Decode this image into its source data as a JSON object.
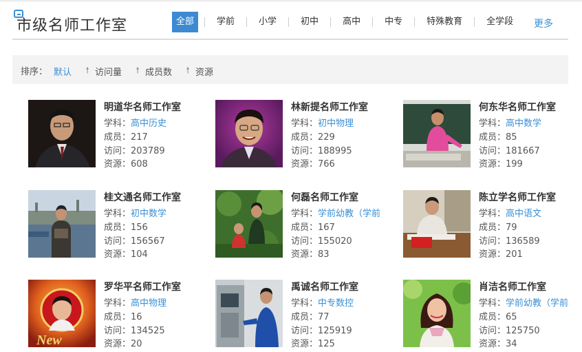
{
  "header": {
    "title": "市级名师工作室",
    "nav": [
      "全部",
      "学前",
      "小学",
      "初中",
      "高中",
      "中专",
      "特殊教育",
      "全学段"
    ],
    "active_nav": "全部",
    "more": "更多"
  },
  "sort": {
    "label": "排序：",
    "options": [
      "默认",
      "访问量",
      "成员数",
      "资源"
    ],
    "active": "默认"
  },
  "field_labels": {
    "subject": "学科：",
    "members": "成员：",
    "visits": "访问：",
    "resources": "资源："
  },
  "studios": [
    {
      "name": "明道华名师工作室",
      "subject": "高中历史",
      "members": "217",
      "visits": "203789",
      "resources": "608"
    },
    {
      "name": "林新提名师工作室",
      "subject": "初中物理",
      "members": "229",
      "visits": "188995",
      "resources": "766"
    },
    {
      "name": "何东华名师工作室",
      "subject": "高中数学",
      "members": "85",
      "visits": "181667",
      "resources": "199"
    },
    {
      "name": "桂文通名师工作室",
      "subject": "初中数学",
      "members": "156",
      "visits": "156567",
      "resources": "104"
    },
    {
      "name": "何磊名师工作室",
      "subject": "学前幼教（学前",
      "members": "167",
      "visits": "155020",
      "resources": "83"
    },
    {
      "name": "陈立学名师工作室",
      "subject": "高中语文",
      "members": "79",
      "visits": "136589",
      "resources": "201"
    },
    {
      "name": "罗华平名师工作室",
      "subject": "高中物理",
      "members": "16",
      "visits": "134525",
      "resources": "20"
    },
    {
      "name": "禹诚名师工作室",
      "subject": "中专数控",
      "members": "77",
      "visits": "125919",
      "resources": "125"
    },
    {
      "name": "肖洁名师工作室",
      "subject": "学前幼教（学前",
      "members": "65",
      "visits": "125750",
      "resources": "34"
    }
  ],
  "colors": {
    "accent": "#3a8fd6",
    "active_tab_bg": "#3d8ad3",
    "sortbar_bg": "#f3f3f3"
  }
}
